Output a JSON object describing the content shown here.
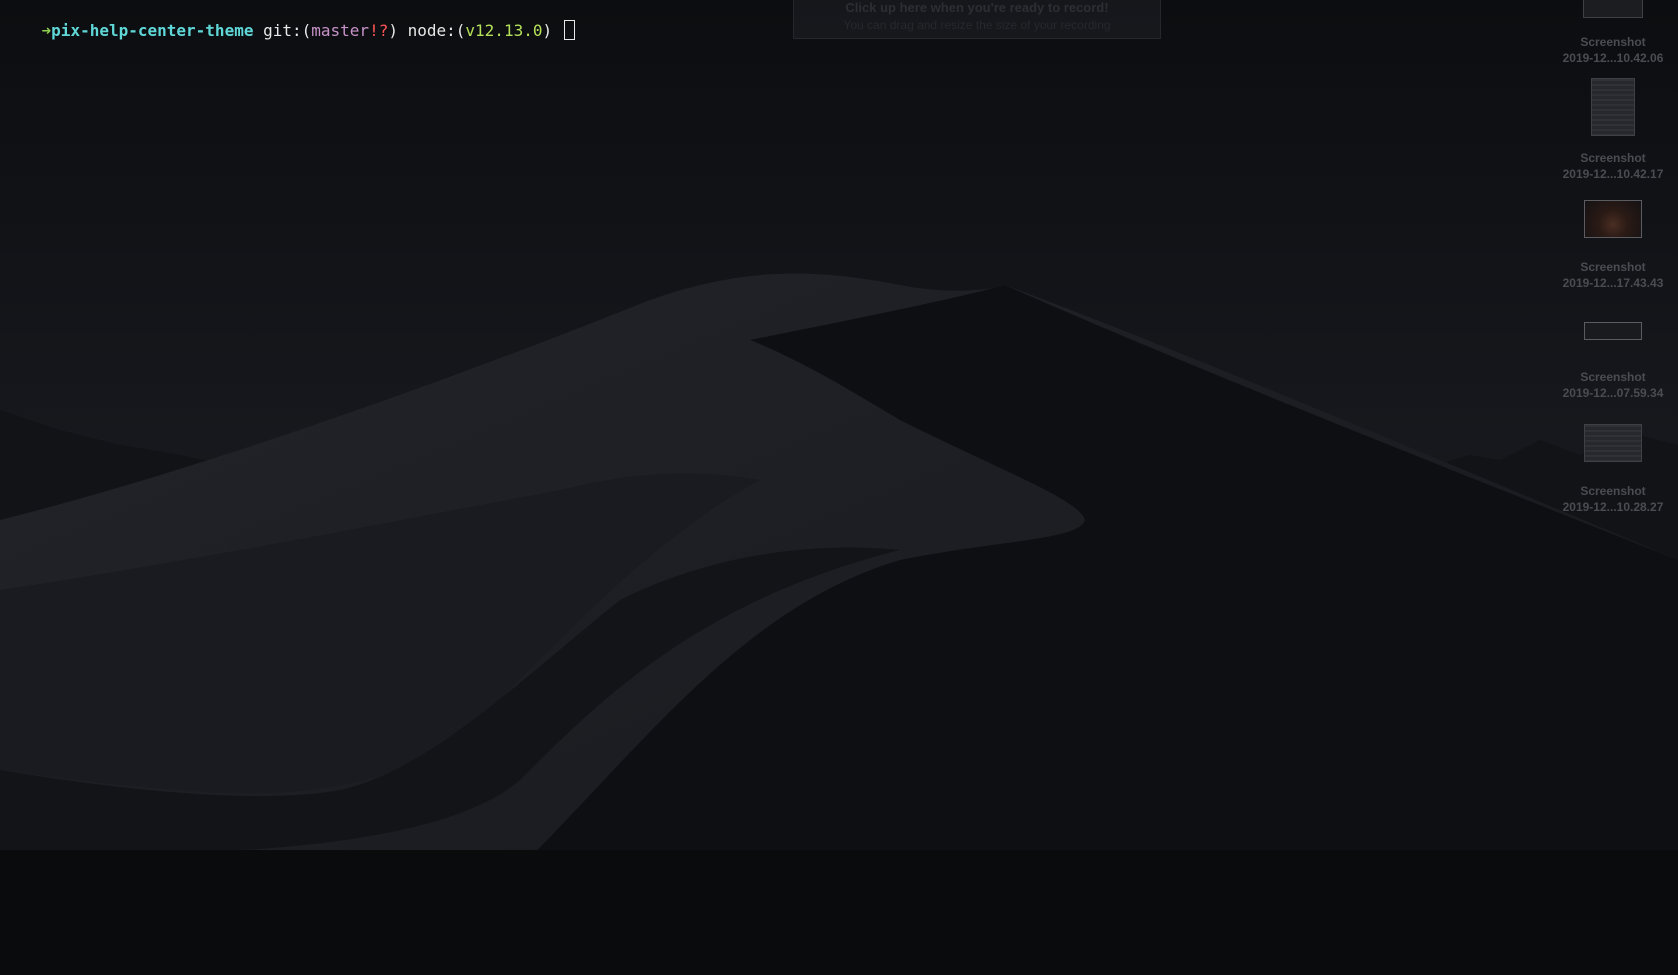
{
  "terminal": {
    "arrow": "➜",
    "directory": "pix-help-center-theme",
    "git_prefix": " git:(",
    "branch": "master",
    "dirty_marker": "!?",
    "git_suffix": ")",
    "node_prefix": " node:(",
    "node_version": "v12.13.0",
    "node_suffix": ") "
  },
  "record_banner": {
    "title": "Click up here when you're ready to record!",
    "subtitle": "You can drag and resize the size of your recording"
  },
  "desktop": {
    "icons": [
      {
        "name": "Screenshot",
        "date": "2019-12...10.42.06",
        "thumb": "document"
      },
      {
        "name": "Screenshot",
        "date": "2019-12...10.42.17",
        "thumb": "document"
      },
      {
        "name": "Screenshot",
        "date": "2019-12...17.43.43",
        "thumb": "photo"
      },
      {
        "name": "Screenshot",
        "date": "2019-12...07.59.34",
        "thumb": "bar"
      },
      {
        "name": "Screenshot",
        "date": "2019-12...10.28.27",
        "thumb": "document"
      }
    ]
  },
  "colors": {
    "background": "#0b0c0f",
    "prompt_arrow": "#8fd14f",
    "prompt_directory": "#5fd7d7",
    "git_branch": "#c792c7",
    "git_dirty": "#ff5555",
    "node_version": "#b5e05a"
  }
}
